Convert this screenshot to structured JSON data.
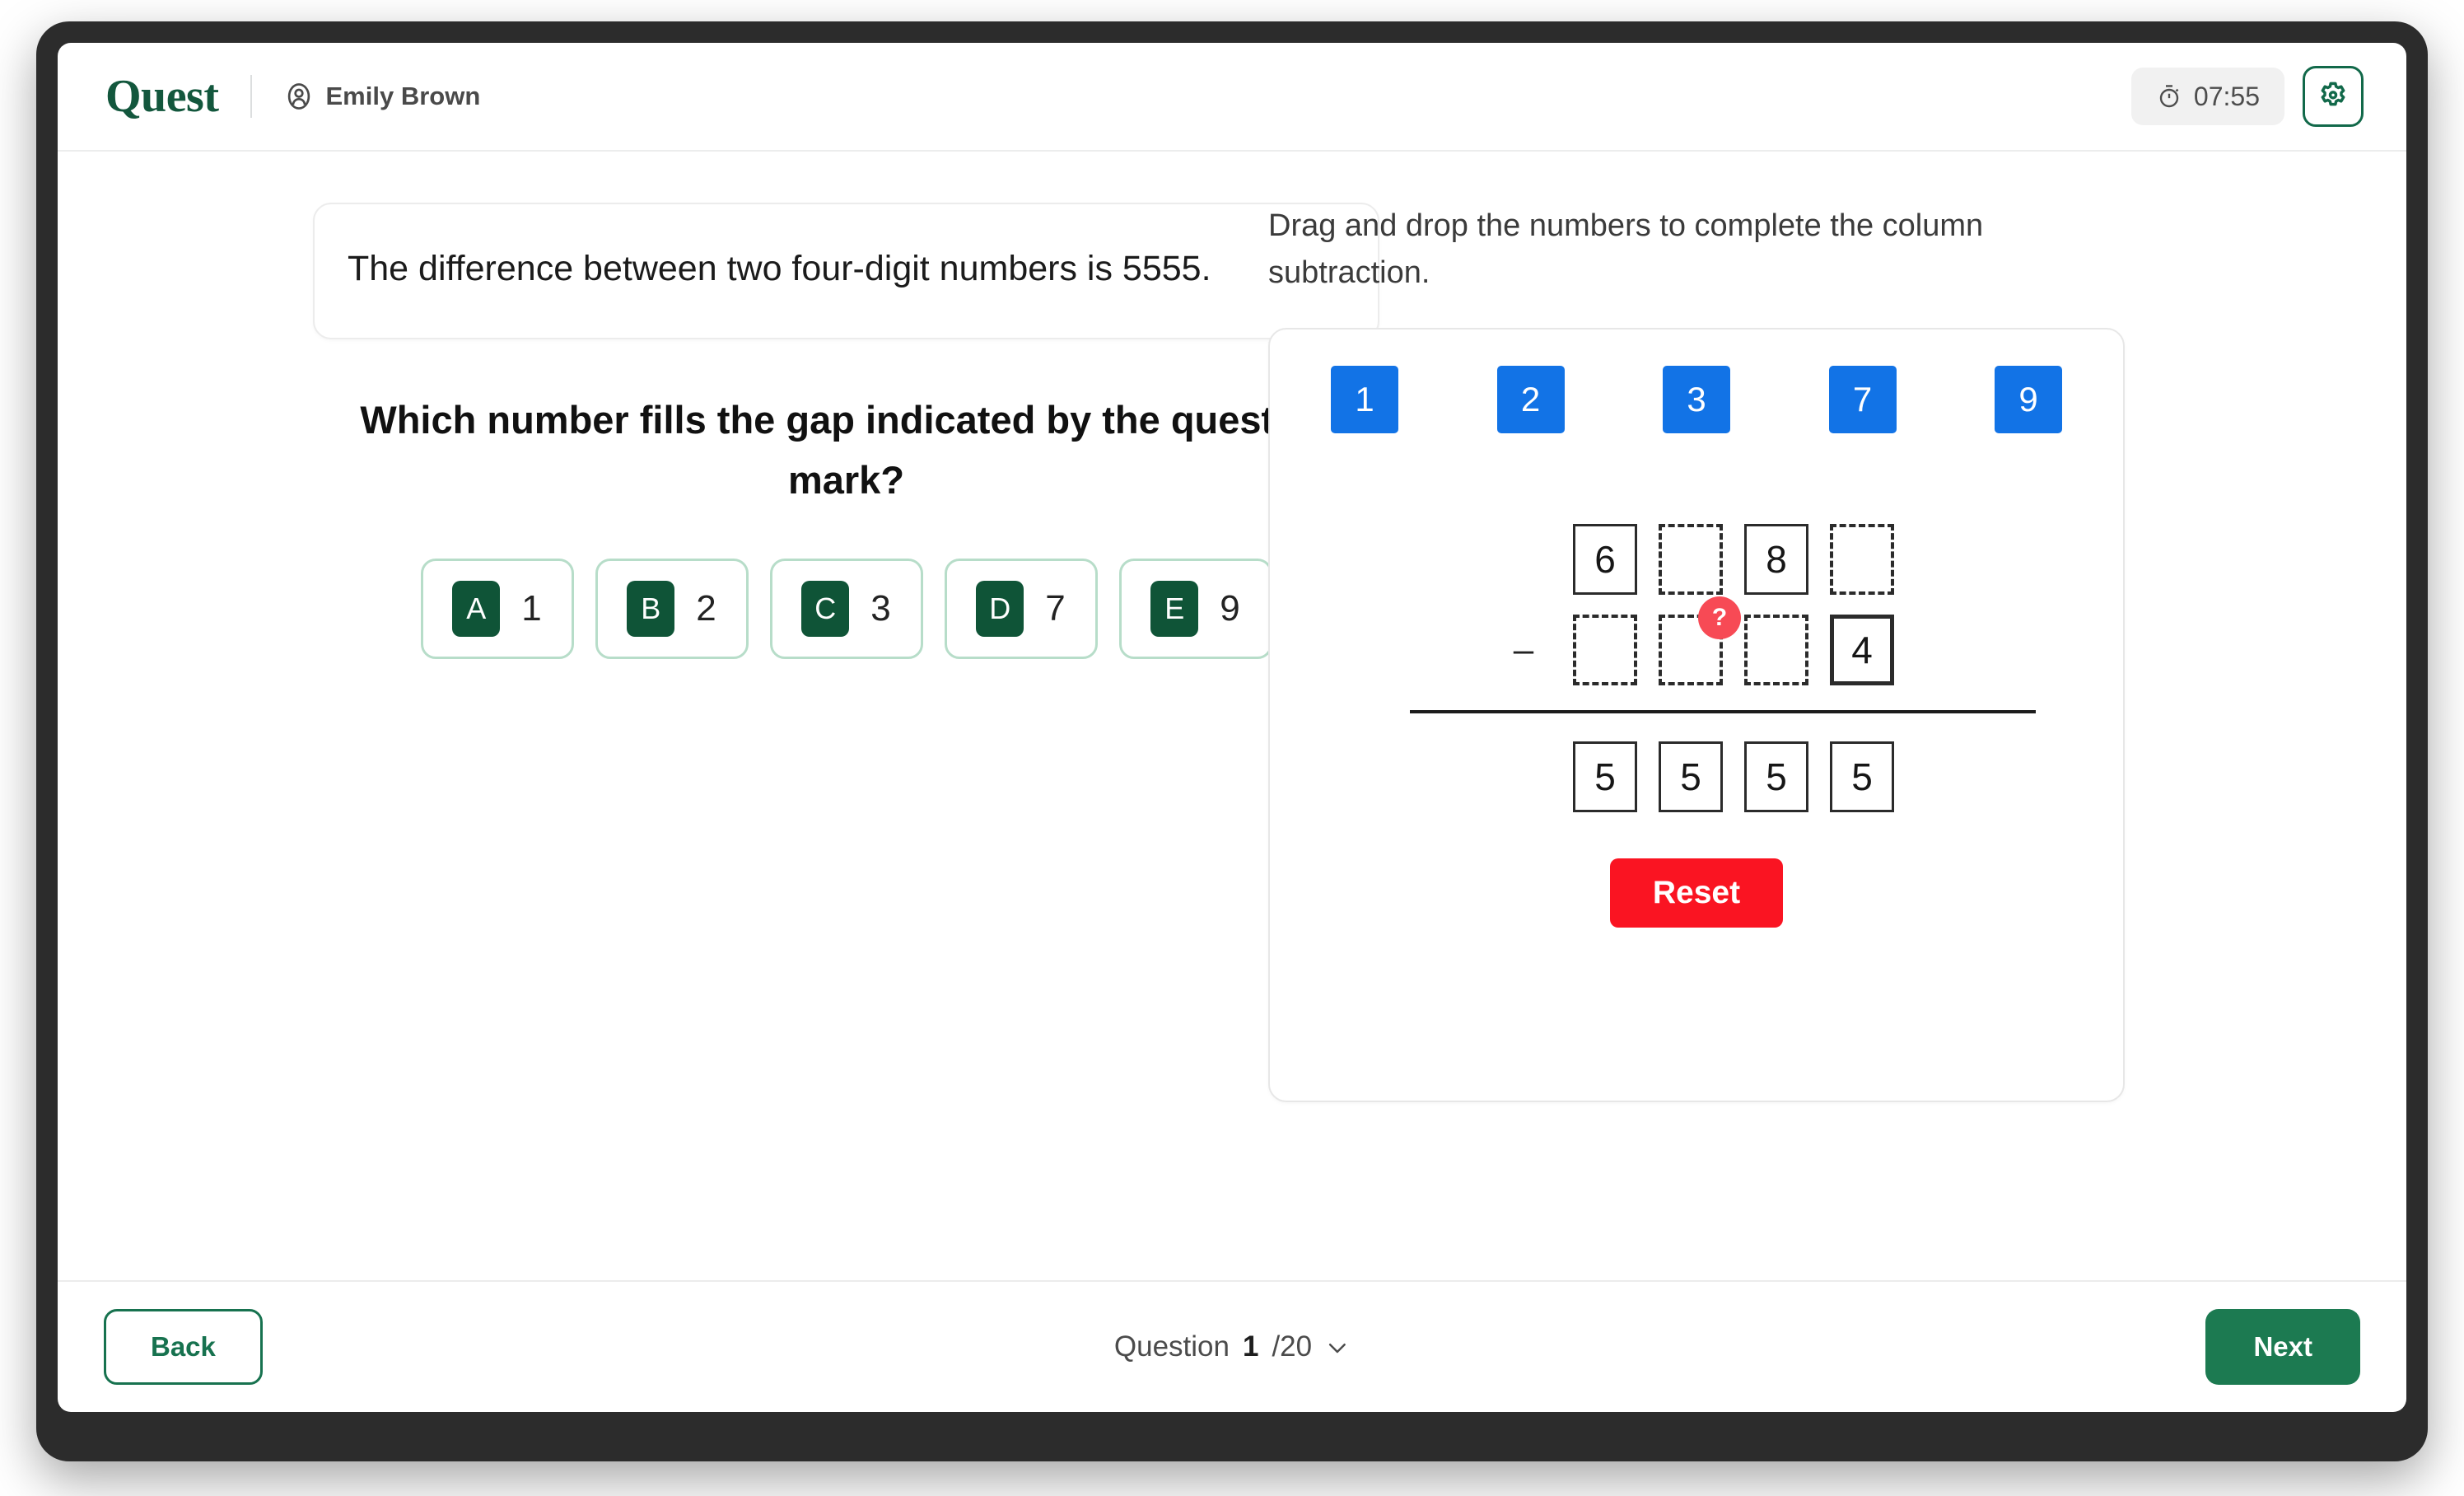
{
  "header": {
    "brand": "Quest",
    "user_name": "Emily Brown",
    "user_icon": "user-circle-icon",
    "timer": "07:55",
    "timer_icon": "stopwatch-icon",
    "settings_icon": "gear-icon",
    "accent_green": "#13573d"
  },
  "passage": {
    "text": "The difference between two four-digit numbers is 5555."
  },
  "question": {
    "title": "Which number fills the gap indicated by the question mark?",
    "options": [
      {
        "letter": "A",
        "text": "1"
      },
      {
        "letter": "B",
        "text": "2"
      },
      {
        "letter": "C",
        "text": "3"
      },
      {
        "letter": "D",
        "text": "7"
      },
      {
        "letter": "E",
        "text": "9"
      }
    ]
  },
  "interactive": {
    "instruction": "Drag and drop the numbers to complete the column subtraction.",
    "tiles": [
      "1",
      "2",
      "3",
      "7",
      "9"
    ],
    "tile_color": "#1273e6",
    "rows": {
      "minuend": [
        {
          "value": "6",
          "filled": true
        },
        {
          "value": "",
          "filled": false
        },
        {
          "value": "8",
          "filled": true
        },
        {
          "value": "",
          "filled": false
        }
      ],
      "operator": "–",
      "subtrahend": [
        {
          "value": "",
          "filled": false
        },
        {
          "value": "",
          "filled": false,
          "badge": "?"
        },
        {
          "value": "",
          "filled": false
        },
        {
          "value": "4",
          "filled": true
        }
      ],
      "result": [
        {
          "value": "5",
          "filled": true
        },
        {
          "value": "5",
          "filled": true
        },
        {
          "value": "5",
          "filled": true
        },
        {
          "value": "5",
          "filled": true
        }
      ]
    },
    "badge_color": "#f74a55",
    "reset_label": "Reset",
    "reset_color": "#fa1422"
  },
  "footer": {
    "back_label": "Back",
    "question_label": "Question",
    "question_current": "1",
    "question_total": "/20",
    "chevron_icon": "chevron-down-icon",
    "next_label": "Next"
  }
}
